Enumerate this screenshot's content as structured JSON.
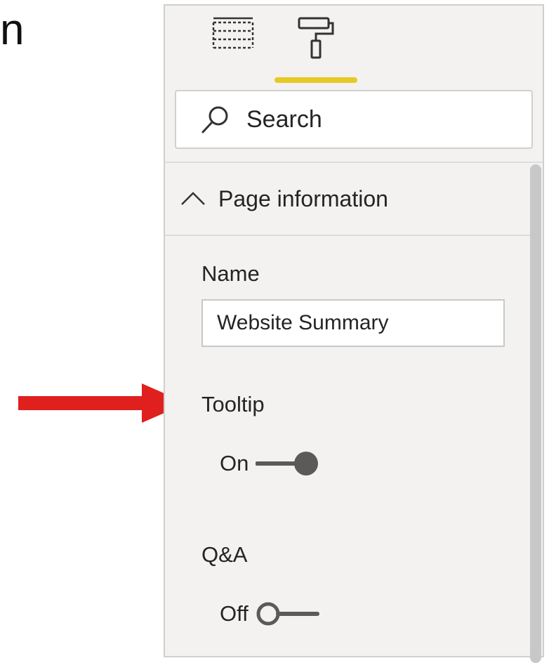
{
  "background": {
    "partial_heading": "n"
  },
  "colors": {
    "accent_underline": "#e8c824",
    "arrow": "#e0201e",
    "toggle": "#5a5a5a"
  },
  "tabs": [
    {
      "icon": "fields-icon",
      "active": false
    },
    {
      "icon": "format-paint-roller-icon",
      "active": true
    }
  ],
  "search": {
    "placeholder": "Search"
  },
  "section": {
    "title": "Page information",
    "expanded": true
  },
  "fields": {
    "name_label": "Name",
    "name_value": "Website Summary",
    "tooltip_label": "Tooltip",
    "tooltip_state": "On",
    "qa_label": "Q&A",
    "qa_state": "Off"
  }
}
